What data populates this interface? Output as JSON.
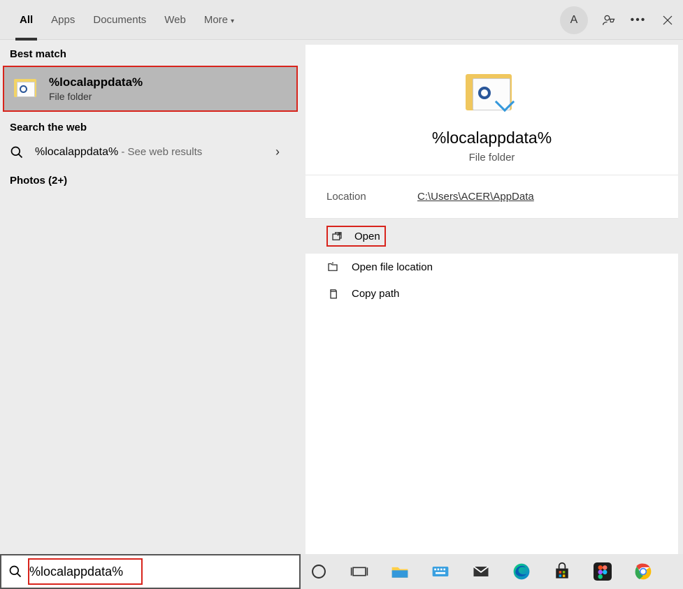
{
  "header": {
    "tabs": [
      "All",
      "Apps",
      "Documents",
      "Web",
      "More"
    ],
    "active_tab_index": 0,
    "avatar_letter": "A"
  },
  "left": {
    "best_match_label": "Best match",
    "best_match": {
      "title": "%localappdata%",
      "subtitle": "File folder"
    },
    "search_web_label": "Search the web",
    "web_result": {
      "term": "%localappdata%",
      "suffix": " - See web results"
    },
    "photos_label": "Photos (2+)"
  },
  "right": {
    "title": "%localappdata%",
    "subtitle": "File folder",
    "location_label": "Location",
    "location_value": "C:\\Users\\ACER\\AppData",
    "actions": {
      "open": "Open",
      "open_location": "Open file location",
      "copy_path": "Copy path"
    }
  },
  "search": {
    "value": "%localappdata%"
  },
  "taskbar": {
    "items": [
      "cortana",
      "task-view",
      "file-explorer",
      "keyboard",
      "mail",
      "edge",
      "store",
      "figma",
      "chrome"
    ]
  }
}
